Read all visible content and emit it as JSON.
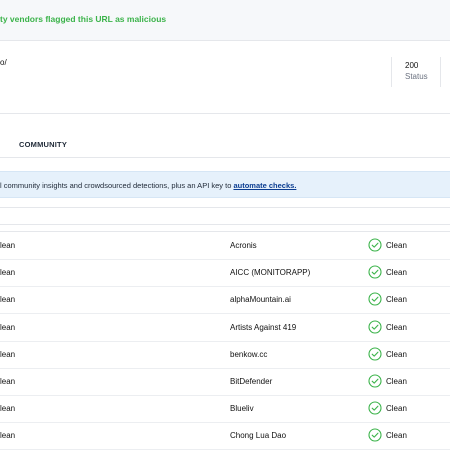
{
  "banner": {
    "text": "ty vendors flagged this URL as malicious"
  },
  "url": {
    "text": "o/"
  },
  "status": {
    "code": "200",
    "label": "Status"
  },
  "tabs": {
    "community": "COMMUNITY"
  },
  "info": {
    "text": "l community insights and crowdsourced detections, plus an API key to ",
    "link": "automate checks."
  },
  "colors": {
    "clean_green": "#3bb34a",
    "info_bg": "#e6f1fb",
    "link": "#0b3d91"
  },
  "rows": [
    {
      "left_result": "lean",
      "vendor": "Acronis",
      "result": "Clean",
      "icon": "check-circle-icon"
    },
    {
      "left_result": "lean",
      "vendor": "AICC (MONITORAPP)",
      "result": "Clean",
      "icon": "check-circle-icon"
    },
    {
      "left_result": "lean",
      "vendor": "alphaMountain.ai",
      "result": "Clean",
      "icon": "check-circle-icon"
    },
    {
      "left_result": "lean",
      "vendor": "Artists Against 419",
      "result": "Clean",
      "icon": "check-circle-icon"
    },
    {
      "left_result": "lean",
      "vendor": "benkow.cc",
      "result": "Clean",
      "icon": "check-circle-icon"
    },
    {
      "left_result": "lean",
      "vendor": "BitDefender",
      "result": "Clean",
      "icon": "check-circle-icon"
    },
    {
      "left_result": "lean",
      "vendor": "Blueliv",
      "result": "Clean",
      "icon": "check-circle-icon"
    },
    {
      "left_result": "lean",
      "vendor": "Chong Lua Dao",
      "result": "Clean",
      "icon": "check-circle-icon"
    }
  ]
}
